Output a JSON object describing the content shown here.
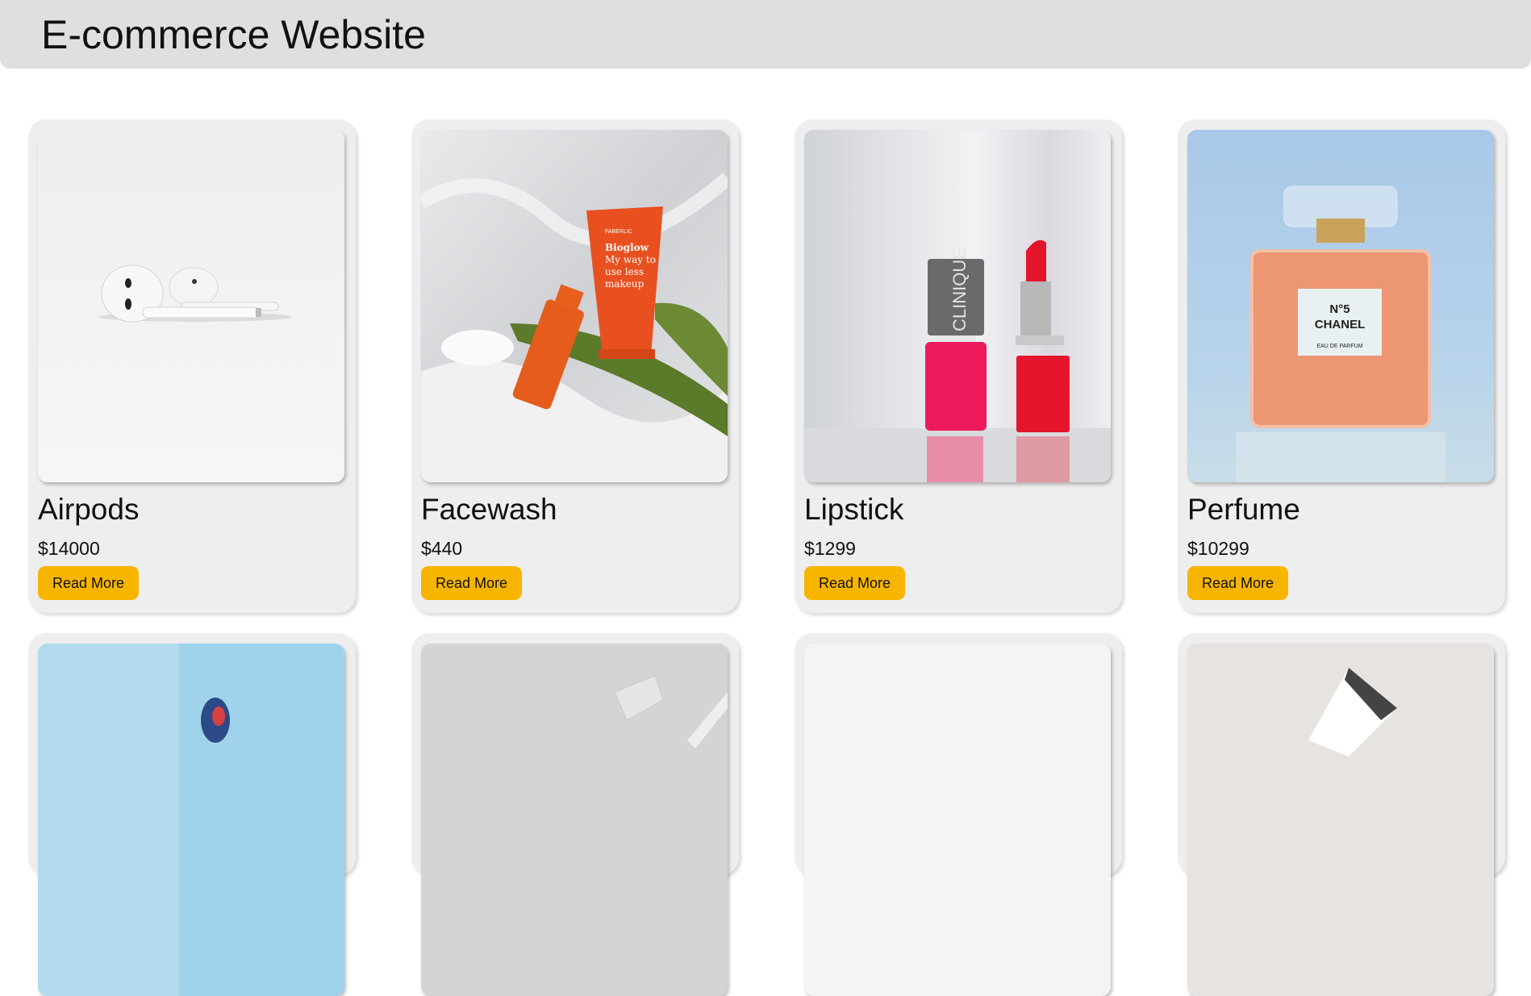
{
  "header": {
    "title": "E-commerce Website"
  },
  "products": [
    {
      "name": "Airpods",
      "price": "$14000",
      "button_label": "Read More",
      "image": "airpods-image"
    },
    {
      "name": "Facewash",
      "price": "$440",
      "button_label": "Read More",
      "image": "facewash-image"
    },
    {
      "name": "Lipstick",
      "price": "$1299",
      "button_label": "Read More",
      "image": "lipstick-image"
    },
    {
      "name": "Perfume",
      "price": "$10299",
      "button_label": "Read More",
      "image": "perfume-image"
    },
    {
      "name": "",
      "price": "",
      "button_label": "",
      "image": "hat-image"
    },
    {
      "name": "",
      "price": "",
      "button_label": "",
      "image": "watch-image"
    },
    {
      "name": "",
      "price": "",
      "button_label": "",
      "image": "white-product-image"
    },
    {
      "name": "",
      "price": "",
      "button_label": "",
      "image": "bag-image"
    }
  ],
  "image_labels": {
    "facewash_brand": "FABERLIC",
    "facewash_line1": "Bioglow",
    "facewash_line2": "My way to",
    "facewash_line3": "use less",
    "facewash_line4": "makeup",
    "lipstick_brand": "CLINIQUE",
    "perfume_line1": "N°5",
    "perfume_line2": "CHANEL",
    "perfume_line3": "EAU DE PARFUM"
  }
}
